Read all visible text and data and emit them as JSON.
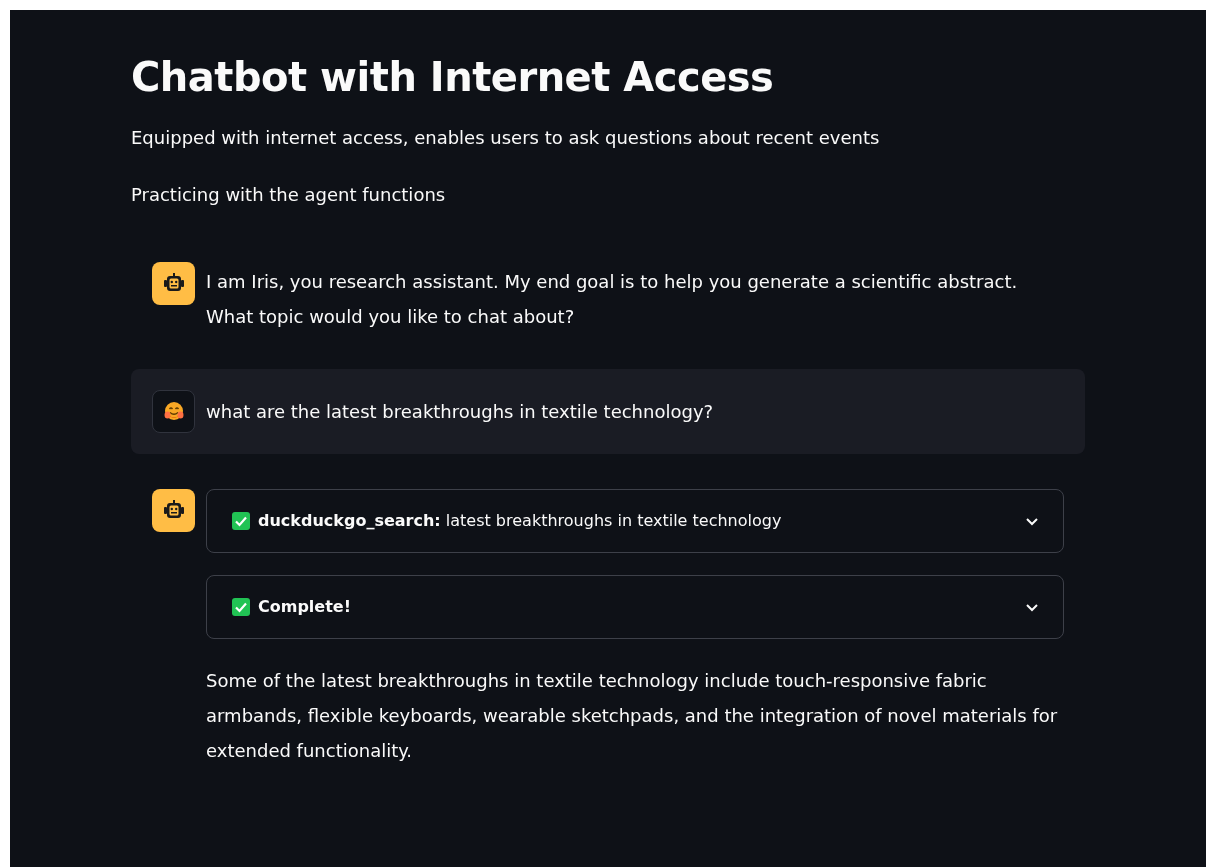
{
  "title": "Chatbot with Internet Access",
  "paragraphs": [
    "Equipped with internet access, enables users to ask questions about recent events",
    "Practicing with the agent functions"
  ],
  "messages": [
    {
      "kind": "assistant",
      "text": "I am Iris, you research assistant. My end goal is to help you generate a scientific abstract. What topic would you like to chat about?"
    },
    {
      "kind": "user",
      "text": "what are the latest breakthroughs in textile technology?"
    },
    {
      "kind": "assistant",
      "steps": [
        {
          "label": "**duckduckgo_search:** latest breakthroughs in textile technology",
          "done": true,
          "expanded": false
        },
        {
          "label": "Complete!",
          "done": true,
          "expanded": false
        }
      ],
      "text": "Some of the latest breakthroughs in textile technology include touch-responsive fabric armbands, flexible keyboards, wearable sketchpads, and the integration of novel materials for extended functionality."
    }
  ]
}
